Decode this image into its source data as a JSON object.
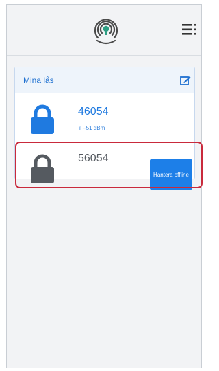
{
  "header": {
    "logo_icon": "fingerprint-key-logo",
    "menu_icon": "menu-icon"
  },
  "locks_panel": {
    "title": "Mina lås",
    "edit_icon": "edit-icon",
    "locks": [
      {
        "name": "46054",
        "signal": "–51 dBm",
        "status_color": "#1f7ae0",
        "icon": "lock-icon"
      },
      {
        "name": "56054",
        "status_color": "#555a60",
        "icon": "lock-icon",
        "action_label": "Hantera offline"
      }
    ]
  },
  "colors": {
    "accent": "#1d7fe8",
    "highlight": "#c92a3c"
  }
}
